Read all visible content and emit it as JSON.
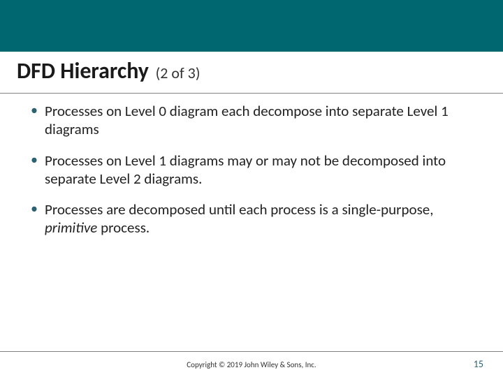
{
  "header": {
    "title_main": "DFD Hierarchy",
    "title_paren": "(2 of 3)"
  },
  "bullets": [
    {
      "text_a": "Processes on Level 0 diagram each decompose into separate Level 1 diagrams",
      "italic": "",
      "text_b": ""
    },
    {
      "text_a": "Processes on Level 1 diagrams may or may not be decomposed into separate Level 2 diagrams.",
      "italic": "",
      "text_b": ""
    },
    {
      "text_a": "Processes are decomposed until each process is a single-purpose, ",
      "italic": "primitive",
      "text_b": " process."
    }
  ],
  "footer": {
    "copyright": "Copyright © 2019 John Wiley & Sons, Inc.",
    "page": "15"
  },
  "colors": {
    "accent": "#006770",
    "bullet": "#2b6171"
  }
}
